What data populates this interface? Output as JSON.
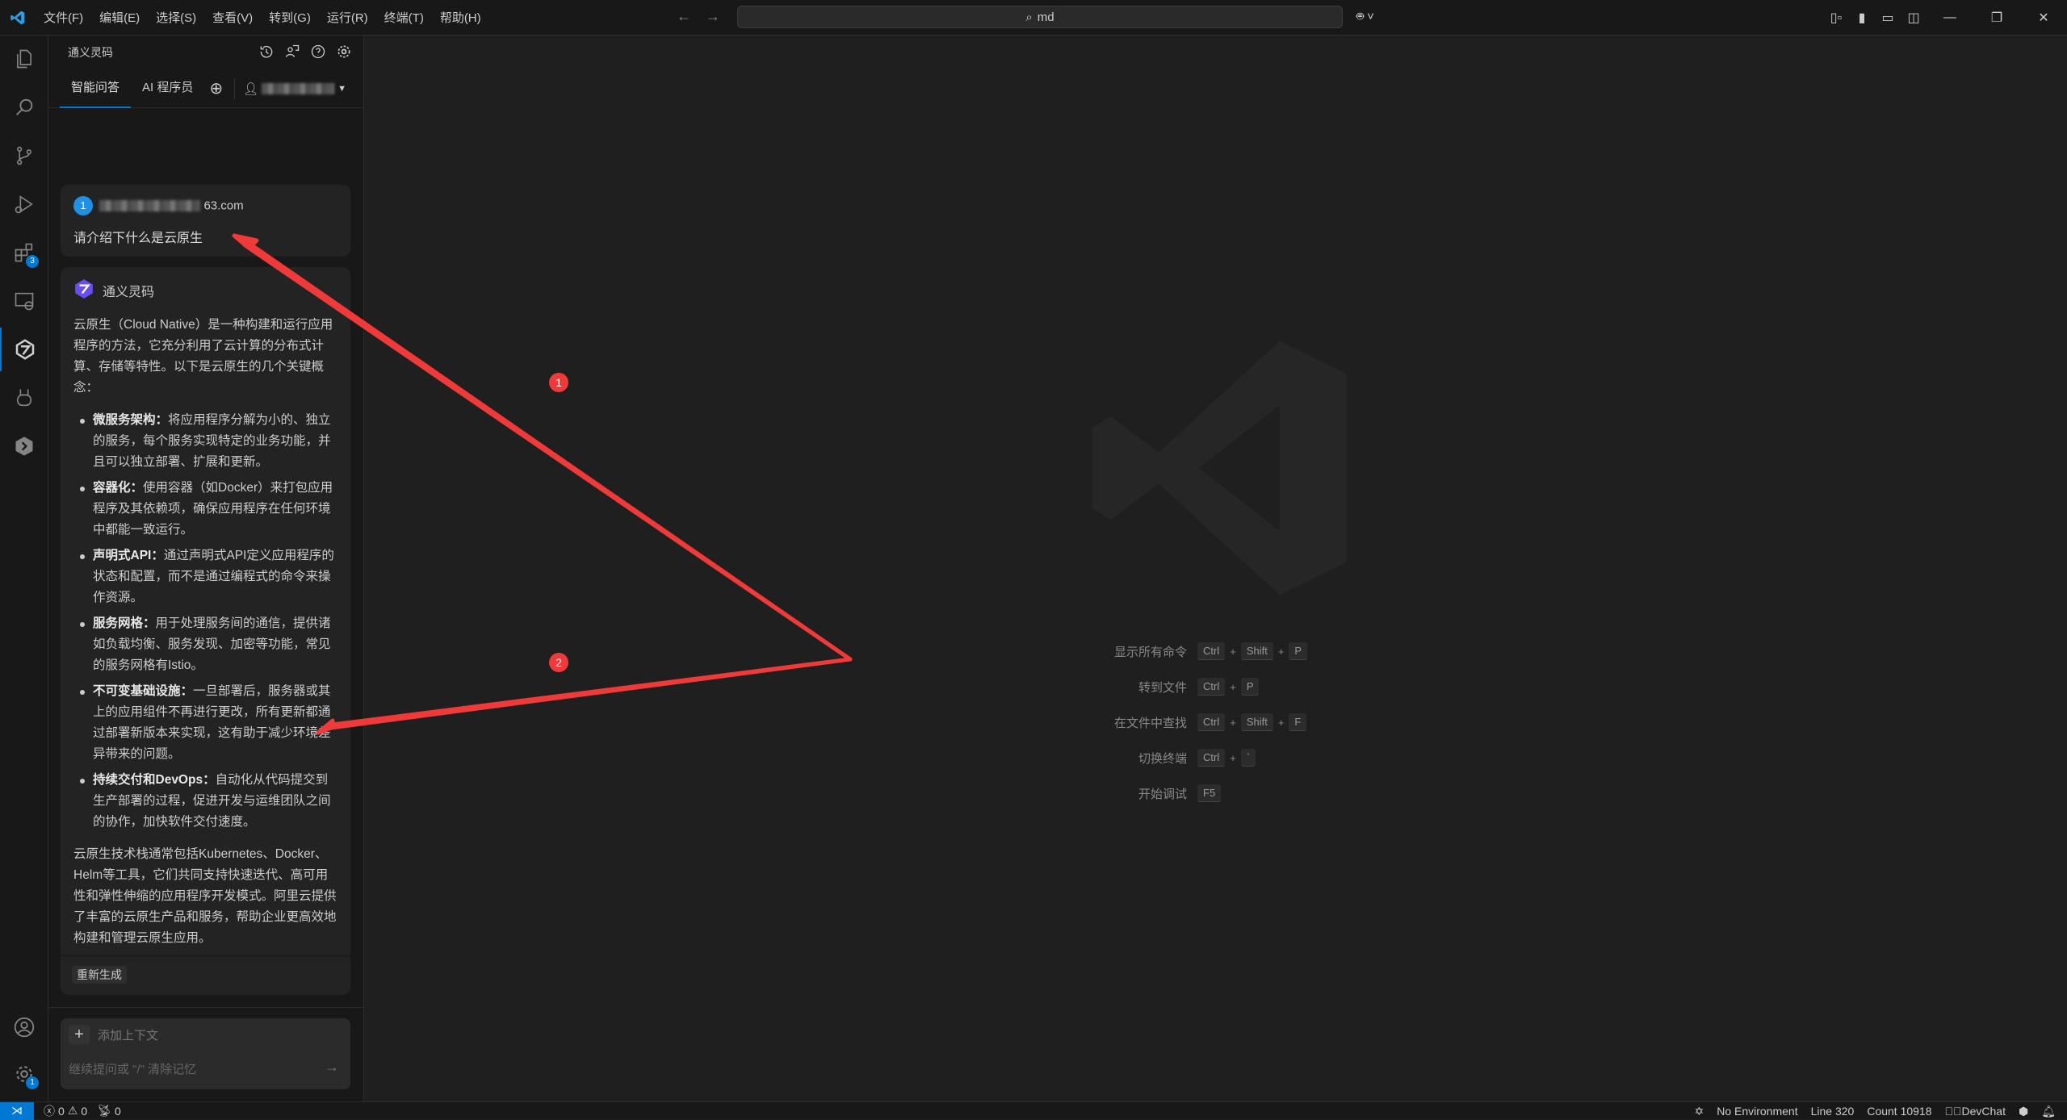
{
  "titlebar": {
    "menu": [
      "文件(F)",
      "编辑(E)",
      "选择(S)",
      "查看(V)",
      "转到(G)",
      "运行(R)",
      "终端(T)",
      "帮助(H)"
    ],
    "search": "md",
    "accent": "#0078d4"
  },
  "activity_bar": {
    "extensions_badge": "3",
    "settings_badge": "1"
  },
  "side_panel": {
    "title": "通义灵码",
    "tabs": [
      "智能问答",
      "AI 程序员"
    ],
    "active_tab": "智能问答",
    "user_card": {
      "avatar": "1",
      "email_suffix": "63.com",
      "question": "请介绍下什么是云原生"
    },
    "ai_card": {
      "name": "通义灵码",
      "intro": "云原生（Cloud Native）是一种构建和运行应用程序的方法，它充分利用了云计算的分布式计算、存储等特性。以下是云原生的几个关键概念：",
      "items": [
        {
          "title": "微服务架构",
          "text": "将应用程序分解为小的、独立的服务，每个服务实现特定的业务功能，并且可以独立部署、扩展和更新。"
        },
        {
          "title": "容器化",
          "text": "使用容器（如Docker）来打包应用程序及其依赖项，确保应用程序在任何环境中都能一致运行。"
        },
        {
          "title": "声明式API",
          "text": "通过声明式API定义应用程序的状态和配置，而不是通过编程式的命令来操作资源。"
        },
        {
          "title": "服务网格",
          "text": "用于处理服务间的通信，提供诸如负载均衡、服务发现、加密等功能，常见的服务网格有Istio。"
        },
        {
          "title": "不可变基础设施",
          "text": "一旦部署后，服务器或其上的应用组件不再进行更改，所有更新都通过部署新版本来实现，这有助于减少环境差异带来的问题。"
        },
        {
          "title": "持续交付和DevOps",
          "text": "自动化从代码提交到生产部署的过程，促进开发与运维团队之间的协作，加快软件交付速度。"
        }
      ],
      "summary": "云原生技术栈通常包括Kubernetes、Docker、Helm等工具，它们共同支持快速迭代、高可用性和弹性伸缩的应用程序开发模式。阿里云提供了丰富的云原生产品和服务，帮助企业更高效地构建和管理云原生应用。",
      "regenerate": "重新生成"
    },
    "input": {
      "add_context": "添加上下文",
      "placeholder": "继续提问或 \"/\" 清除记忆"
    }
  },
  "welcome": {
    "shortcuts": [
      {
        "label": "显示所有命令",
        "keys": [
          "Ctrl",
          "Shift",
          "P"
        ]
      },
      {
        "label": "转到文件",
        "keys": [
          "Ctrl",
          "P"
        ]
      },
      {
        "label": "在文件中查找",
        "keys": [
          "Ctrl",
          "Shift",
          "F"
        ]
      },
      {
        "label": "切换终端",
        "keys": [
          "Ctrl",
          "`"
        ]
      },
      {
        "label": "开始调试",
        "keys": [
          "F5"
        ]
      }
    ]
  },
  "annotations": {
    "badge1": "1",
    "badge2": "2",
    "color": "#f03a3a"
  },
  "statusbar": {
    "errors": "0",
    "warnings": "0",
    "ports": "0",
    "environment": "No Environment",
    "line": "Line 320",
    "count": "Count 10918",
    "devchat": "DevChat"
  }
}
